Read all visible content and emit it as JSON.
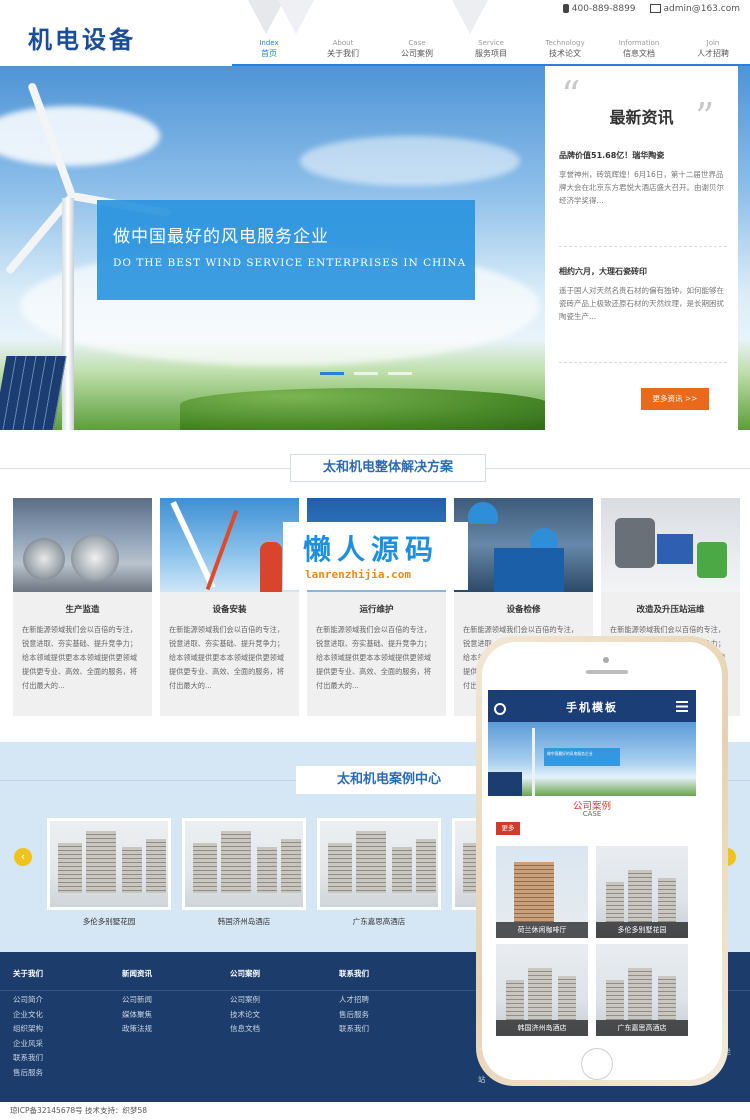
{
  "header": {
    "logo": "机电设备",
    "phone": "400-889-8899",
    "email": "admin@163.com",
    "nav": [
      {
        "en": "Index",
        "cn": "首页",
        "active": true
      },
      {
        "en": "About",
        "cn": "关于我们"
      },
      {
        "en": "Case",
        "cn": "公司案例"
      },
      {
        "en": "Service",
        "cn": "服务项目"
      },
      {
        "en": "Technology",
        "cn": "技术论文"
      },
      {
        "en": "Information",
        "cn": "信息文档"
      },
      {
        "en": "Join",
        "cn": "人才招聘"
      }
    ]
  },
  "hero": {
    "title": "做中国最好的风电服务企业",
    "subtitle": "DO THE BEST WIND SERVICE ENTERPRISES IN CHINA"
  },
  "news": {
    "heading": "最新资讯",
    "items": [
      {
        "title": "品牌价值51.68亿！瑞华陶瓷",
        "desc": "享誉神州，砖筑辉煌！6月16日，第十二届世界品牌大会在北京东方君悦大酒店盛大召开。由谢贝尔经济学奖得..."
      },
      {
        "title": "相约六月，大理石瓷砖印",
        "desc": "遥于国人对天然名贵石材的偏有独钟，如何能够在瓷砖产品上极致还原石材的天然纹理，是长期困扰陶瓷生产..."
      }
    ],
    "more": "更多资讯 >>"
  },
  "solutions": {
    "title": "太和机电整体解决方案",
    "items": [
      {
        "name": "生产监造",
        "desc": "在新能源领域我们会以百倍的专注，锐意进取、夯实基础、提升竞争力；给本领域提供更本本领域提供更领域提供更专业、高效、全面的服务，将付出最大的..."
      },
      {
        "name": "设备安装",
        "desc": "在新能源领域我们会以百倍的专注，锐意进取、夯实基础、提升竞争力；给本领域提供更本本领域提供更领域提供更专业、高效、全面的服务，将付出最大的..."
      },
      {
        "name": "运行维护",
        "desc": "在新能源领域我们会以百倍的专注，锐意进取、夯实基础、提升竞争力；给本领域提供更本本领域提供更领域提供更专业、高效、全面的服务，将付出最大的..."
      },
      {
        "name": "设备检修",
        "desc": "在新能源领域我们会以百倍的专注，锐意进取、夯实基础、提升竞争力；给本领域提供更本本领域提供更领域提供更专业、高效、全面的服务，将付出最大的..."
      },
      {
        "name": "改造及升压站运维",
        "desc": "在新能源领域我们会以百倍的专注，锐意进取、夯实基础、提升竞争力；给本领域提供更本本领域提供更领域提供更专业、高效、全面的服务，将付出最大的..."
      }
    ]
  },
  "cases": {
    "title": "太和机电案例中心",
    "prev": "‹",
    "next": "›",
    "items": [
      {
        "name": "多伦多别墅花园"
      },
      {
        "name": "韩国济州岛酒店"
      },
      {
        "name": "广东嘉思高酒店"
      },
      {
        "name": ""
      }
    ]
  },
  "footer": {
    "cols": [
      {
        "heading": "关于我们",
        "links": [
          "公司简介",
          "企业文化",
          "组织架构",
          "企业风采",
          "联系我们",
          "售后服务"
        ]
      },
      {
        "heading": "新闻资讯",
        "links": [
          "公司新闻",
          "媒体聚焦",
          "政策法规"
        ]
      },
      {
        "heading": "公司案例",
        "links": [
          "公司案例",
          "技术论文",
          "信息文档"
        ]
      },
      {
        "heading": "联系我们",
        "links": [
          "人才招聘",
          "售后服务",
          "联系我们"
        ]
      }
    ],
    "copyright": "琼ICP备32145678号 技术支持：织梦58",
    "right_fragments": [
      "乘坐",
      "同时",
      "站"
    ]
  },
  "watermark": {
    "cn": "懒人源码",
    "en": "lanrenzhijia.com"
  },
  "mobile": {
    "title": "手机模板",
    "banner_text": "做中国最好的风电服务企业",
    "section": "公司案例",
    "section_en": "CASE",
    "more": "更多",
    "cases": [
      "荷兰休闲咖啡厅",
      "多伦多别墅花园",
      "韩国济州岛酒店",
      "广东嘉思高酒店"
    ]
  },
  "colors": {
    "brand": "#1a4c9a",
    "accent": "#2b7fd6",
    "orange": "#e96a1b",
    "footer": "#1c3d6b",
    "red": "#d13b2b"
  }
}
